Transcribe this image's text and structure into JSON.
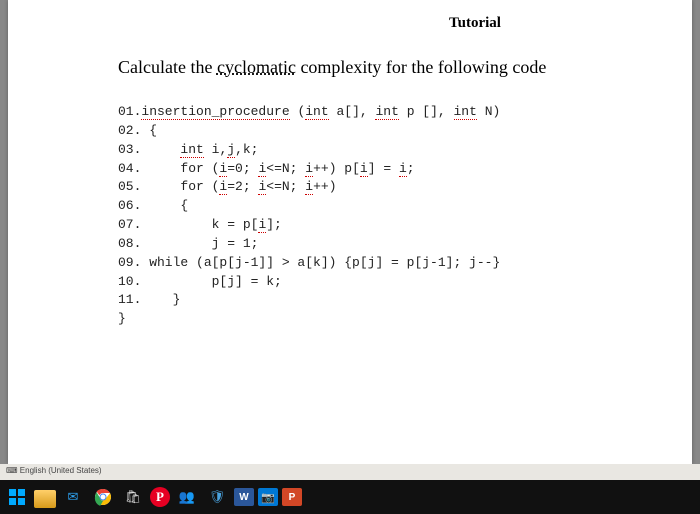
{
  "title": "Tutorial",
  "question_parts": {
    "pre": "Calculate the ",
    "underlined": "cyclomatic",
    "post": " complexity for the following code"
  },
  "code": {
    "l01a": "01.",
    "l01b": "insertion_procedure",
    "l01c": " (",
    "l01d": "int",
    "l01e": " a",
    "l01f": "[], ",
    "l01g": "int",
    "l01h": " p [], ",
    "l01i": "int",
    "l01j": " N)",
    "l02": "02. {",
    "l03a": "03.     ",
    "l03b": "int",
    "l03c": " i",
    "l03d": ",",
    "l03e": "j",
    "l03f": ",k;",
    "l04a": "04.     for (",
    "l04b": "i",
    "l04c": "=0; ",
    "l04d": "i",
    "l04e": "<=N; ",
    "l04f": "i",
    "l04g": "++) p[",
    "l04h": "i",
    "l04i": "] = ",
    "l04j": "i",
    "l04k": ";",
    "l05a": "05.     for (",
    "l05b": "i",
    "l05c": "=2; ",
    "l05d": "i",
    "l05e": "<=N; ",
    "l05f": "i",
    "l05g": "++)",
    "l06": "06.     {",
    "l07a": "07.         k = p[",
    "l07b": "i",
    "l07c": "];",
    "l08": "08.         j = 1;",
    "l09": "09. while (a[p[j-1]] > a[k]) {p[j] = p[j-1]; j--}",
    "l10": "10.         p[j] = k;",
    "l11": "11.    }",
    "l12": "}"
  },
  "statusbar": {
    "lang": "English (United States)"
  },
  "taskbar": {
    "items": [
      {
        "name": "start-button"
      },
      {
        "name": "file-explorer-icon"
      },
      {
        "name": "mail-icon"
      },
      {
        "name": "chrome-icon"
      },
      {
        "name": "store-icon"
      },
      {
        "name": "pinterest-icon"
      },
      {
        "name": "teams-icon"
      },
      {
        "name": "security-icon"
      },
      {
        "name": "word-icon"
      },
      {
        "name": "camera-icon"
      },
      {
        "name": "powerpoint-icon"
      }
    ]
  }
}
